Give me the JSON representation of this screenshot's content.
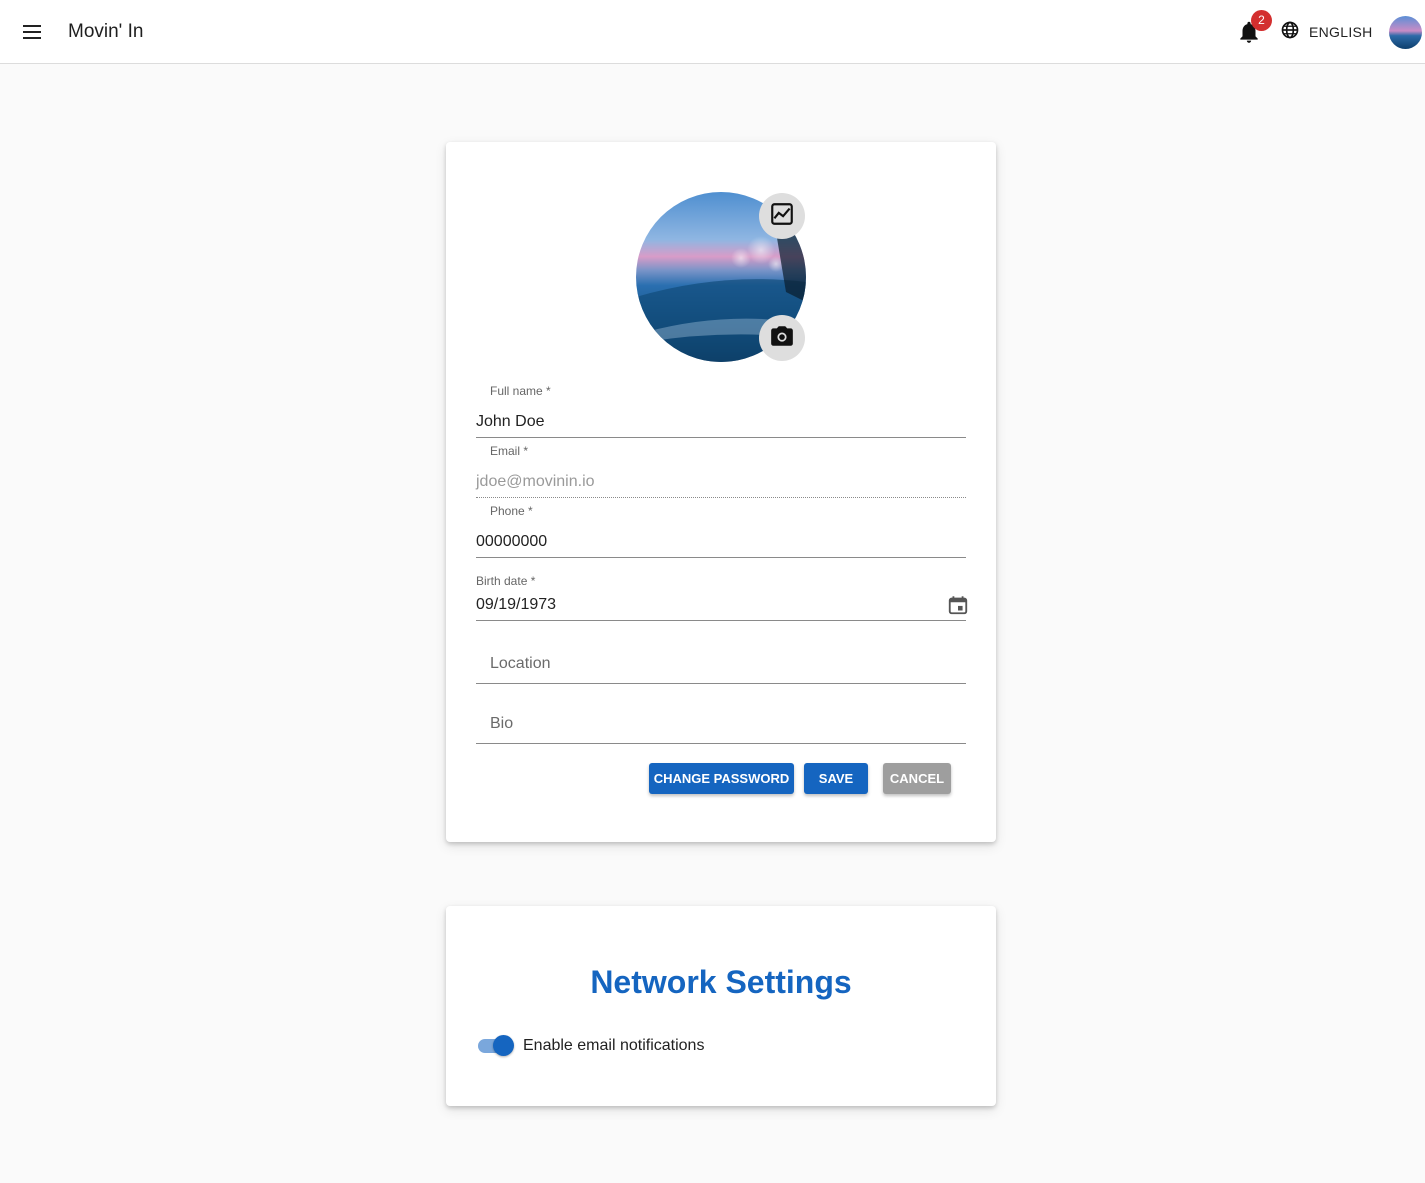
{
  "header": {
    "app_title": "Movin' In",
    "notification_count": "2",
    "language": "ENGLISH"
  },
  "profile": {
    "full_name": {
      "label": "Full name *",
      "value": "John Doe"
    },
    "email": {
      "label": "Email *",
      "value": "jdoe@movinin.io"
    },
    "phone": {
      "label": "Phone *",
      "value": "00000000"
    },
    "birth_date": {
      "label": "Birth date *",
      "value": "09/19/1973"
    },
    "location": {
      "placeholder": "Location"
    },
    "bio": {
      "placeholder": "Bio"
    },
    "buttons": {
      "change_password": "CHANGE PASSWORD",
      "save": "SAVE",
      "cancel": "CANCEL"
    }
  },
  "network": {
    "title": "Network Settings",
    "email_notifications_label": "Enable email notifications",
    "email_notifications_enabled": true
  },
  "colors": {
    "primary": "#1565c0",
    "badge": "#d32f2f",
    "cancel": "#9e9e9e",
    "background": "#fafafa"
  },
  "icons": [
    "menu-icon",
    "bell-icon",
    "globe-icon",
    "image-icon",
    "camera-icon",
    "calendar-icon"
  ]
}
